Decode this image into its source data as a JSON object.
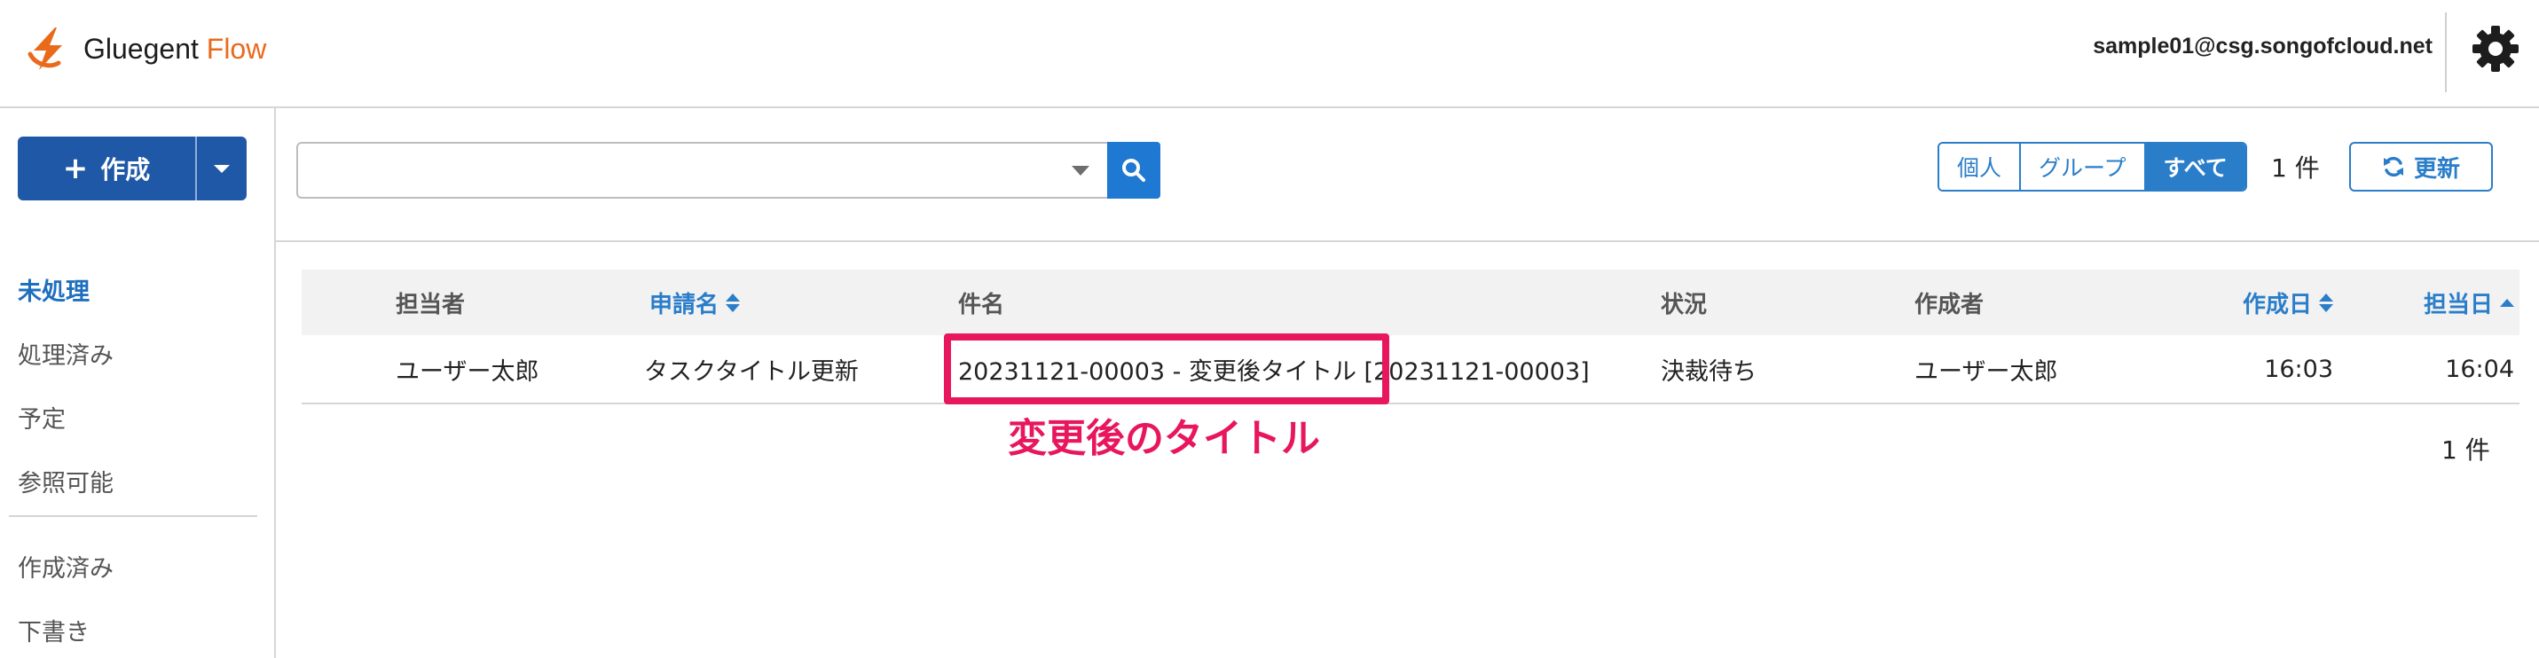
{
  "app": {
    "logo_primary": "Gluegent",
    "logo_accent": "Flow",
    "user_email": "sample01@csg.songofcloud.net"
  },
  "colors": {
    "brand_orange": "#ea6a1c",
    "primary_blue": "#1f58a7",
    "link_blue": "#2a7dc9",
    "annotation_pink": "#e8175d"
  },
  "icons": {
    "logo": "gluegent-flow-logo-icon",
    "settings": "gear-icon",
    "search": "search-icon",
    "refresh": "refresh-icon",
    "create": "plus-icon"
  },
  "sidebar": {
    "create_label": "作成",
    "nav_main": [
      {
        "label": "未処理",
        "active": true
      },
      {
        "label": "処理済み",
        "active": false
      },
      {
        "label": "予定",
        "active": false
      },
      {
        "label": "参照可能",
        "active": false
      }
    ],
    "nav_secondary": [
      {
        "label": "作成済み"
      },
      {
        "label": "下書き"
      }
    ]
  },
  "toolbar": {
    "search_value": "",
    "filters": [
      {
        "label": "個人",
        "active": false
      },
      {
        "label": "グループ",
        "active": false
      },
      {
        "label": "すべて",
        "active": true
      }
    ],
    "count_label": "1 件",
    "refresh_label": "更新"
  },
  "table": {
    "headers": {
      "assignee": "担当者",
      "application_name": "申請名",
      "subject": "件名",
      "status": "状況",
      "creator": "作成者",
      "created_date": "作成日",
      "assigned_date": "担当日"
    },
    "rows": [
      {
        "assignee": "ユーザー太郎",
        "application_name": "タスクタイトル更新",
        "subject": "20231121-00003 - 変更後タイトル [20231121-00003]",
        "status": "決裁待ち",
        "creator": "ユーザー太郎",
        "created_date": "16:03",
        "assigned_date": "16:04"
      }
    ],
    "footer_count": "1 件"
  },
  "annotation": {
    "label": "変更後のタイトル"
  }
}
